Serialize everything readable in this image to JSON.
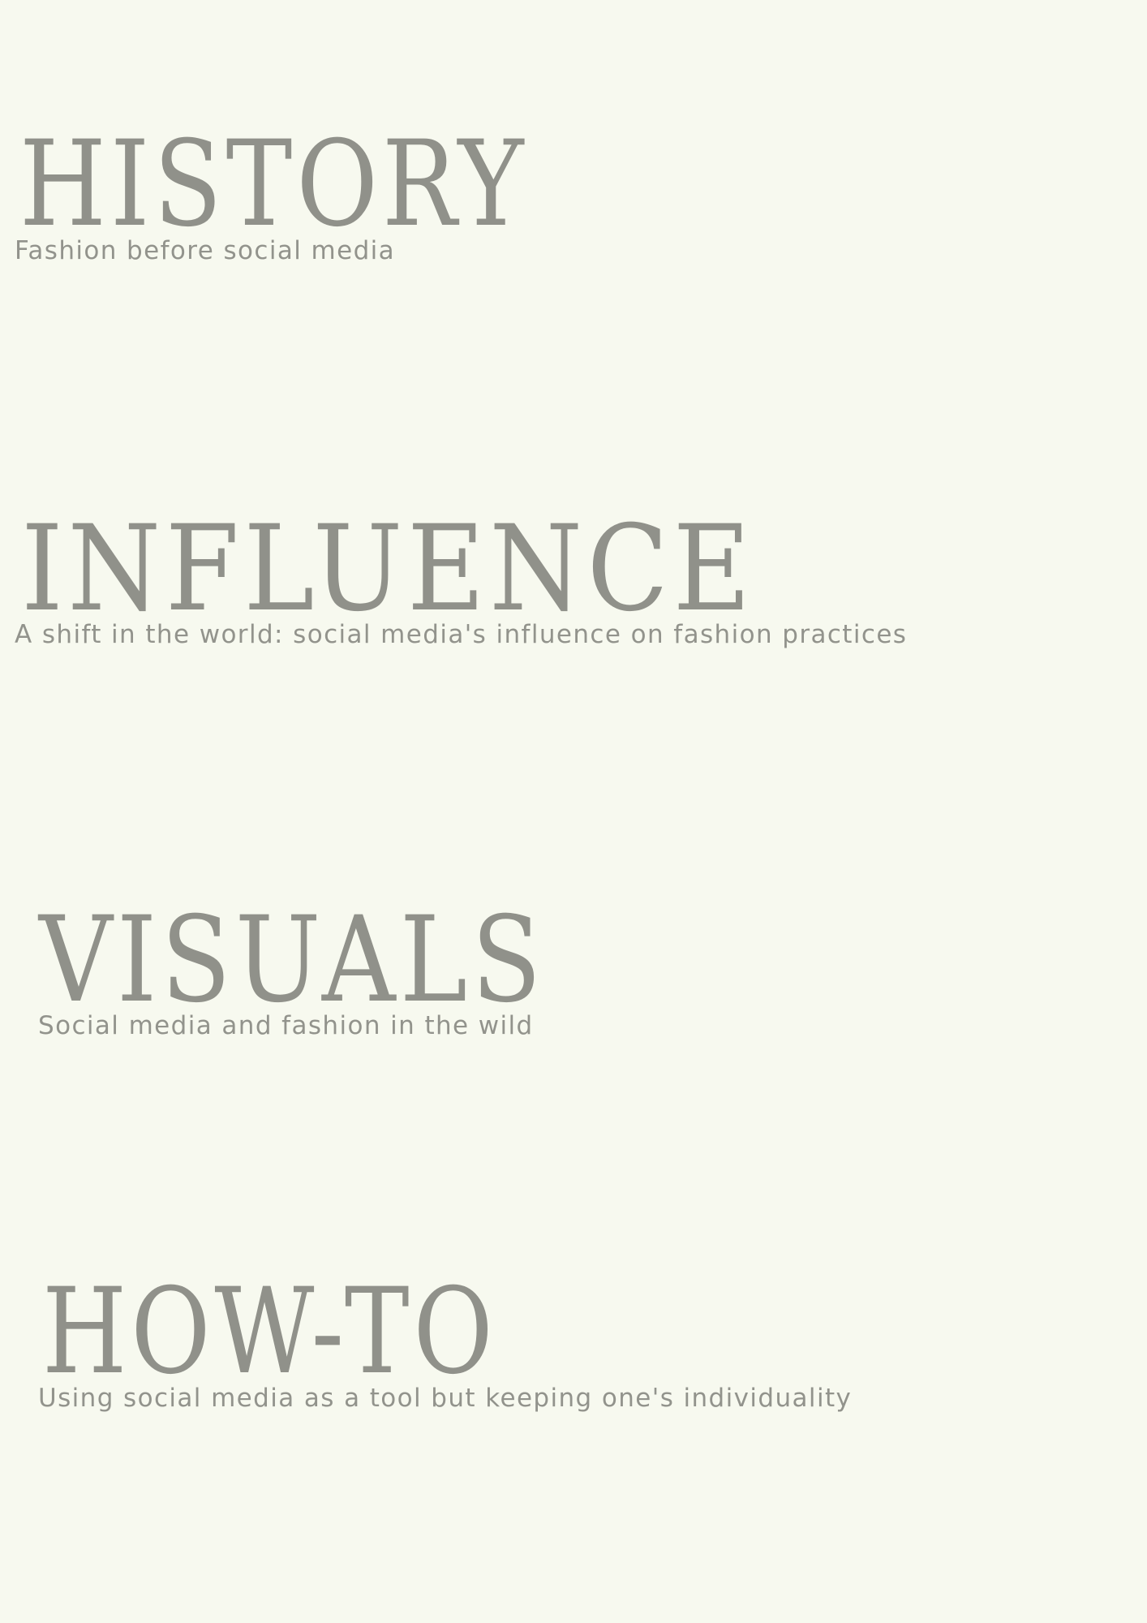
{
  "sections": [
    {
      "title": "HISTORY",
      "subtitle": "Fashion before social media"
    },
    {
      "title": "INFLUENCE",
      "subtitle": "A shift in the world: social media's influence on fashion practices"
    },
    {
      "title": "VISUALS",
      "subtitle": "Social media and fashion in the wild"
    },
    {
      "title": "HOW-TO",
      "subtitle": "Using social media as a tool but keeping one's individuality"
    }
  ],
  "colors": {
    "background": "#f7f9ef",
    "text": "#90918a"
  }
}
